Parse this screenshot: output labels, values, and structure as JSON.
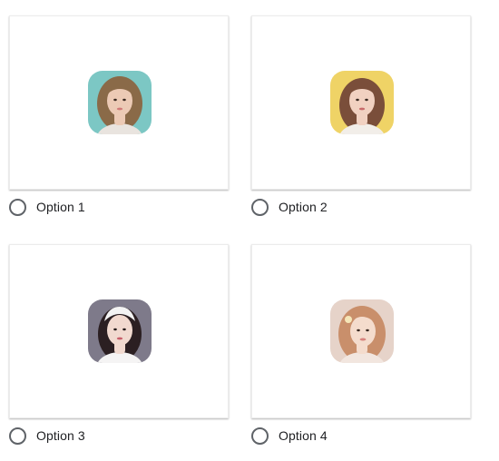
{
  "options": [
    {
      "label": "Option 1",
      "selected": false,
      "image_icon": "portrait-photo-icon",
      "palette": {
        "bg": "#7cc7c4",
        "hair": "#8a6a48",
        "skin": "#eccab5",
        "shirt": "#e9e4df",
        "lips": "#d07a78"
      }
    },
    {
      "label": "Option 2",
      "selected": false,
      "image_icon": "portrait-photo-icon",
      "palette": {
        "bg": "#efd366",
        "hair": "#7a4e3a",
        "skin": "#f1d1c1",
        "shirt": "#f2eee9",
        "lips": "#c86a6a"
      }
    },
    {
      "label": "Option 3",
      "selected": false,
      "image_icon": "portrait-photo-icon",
      "palette": {
        "bg": "#7e7a8a",
        "hair": "#2b1f22",
        "skin": "#f1d9cf",
        "shirt": "#f5f4f4",
        "lips": "#c85e6a"
      }
    },
    {
      "label": "Option 4",
      "selected": false,
      "image_icon": "portrait-photo-icon",
      "palette": {
        "bg": "#e6d3c9",
        "hair": "#c98f6b",
        "skin": "#f4dccd",
        "shirt": "#f2e6df",
        "lips": "#d7837d"
      }
    }
  ],
  "colors": {
    "radio_border": "#5f6368",
    "label_text": "#202124",
    "card_border": "#ececec"
  }
}
